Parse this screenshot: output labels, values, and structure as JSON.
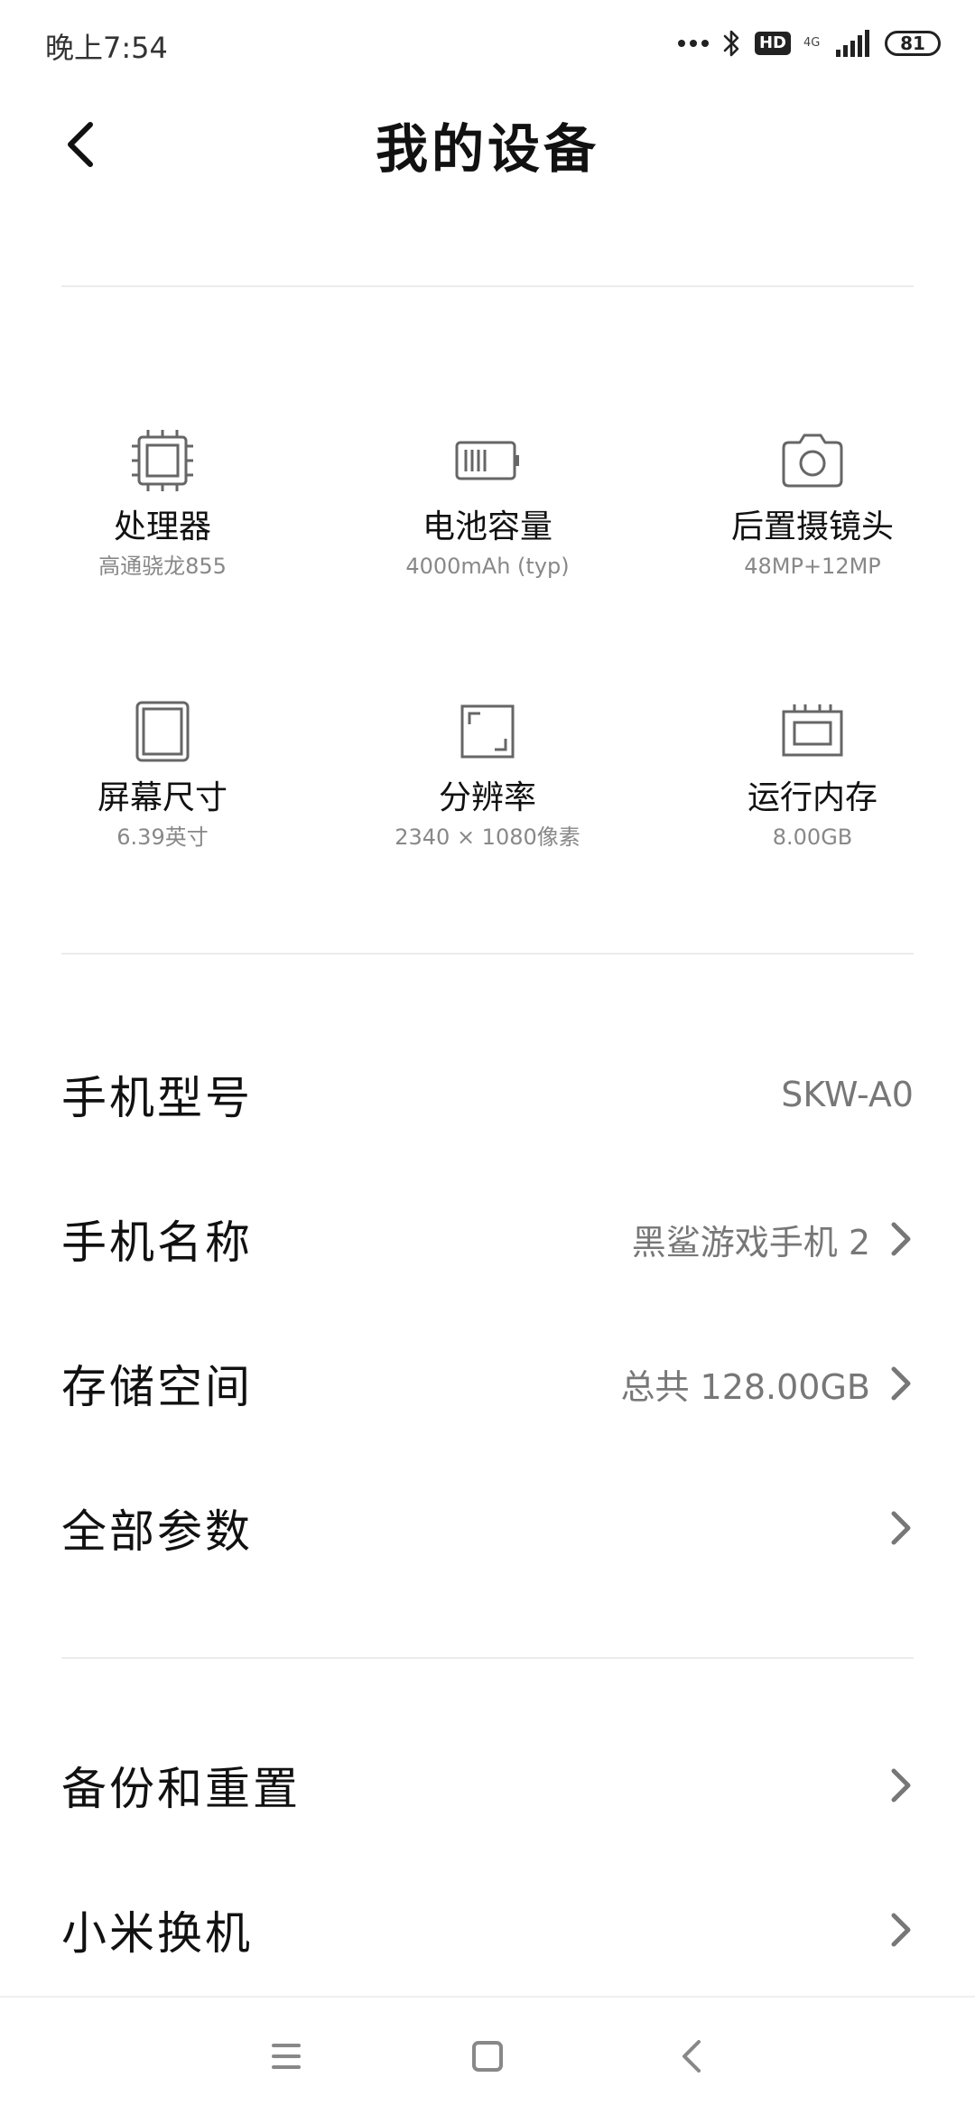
{
  "status_bar": {
    "time": "晚上7:54",
    "network": "4G",
    "hd": "HD",
    "battery": "81"
  },
  "header": {
    "title": "我的设备"
  },
  "specs": [
    {
      "label": "处理器",
      "value": "高通骁龙855",
      "icon": "processor-icon"
    },
    {
      "label": "电池容量",
      "value": "4000mAh (typ)",
      "icon": "battery-icon"
    },
    {
      "label": "后置摄镜头",
      "value": "48MP+12MP",
      "icon": "camera-icon"
    },
    {
      "label": "屏幕尺寸",
      "value": "6.39英寸",
      "icon": "screen-icon"
    },
    {
      "label": "分辨率",
      "value": "2340 × 1080像素",
      "icon": "resolution-icon"
    },
    {
      "label": "运行内存",
      "value": "8.00GB",
      "icon": "memory-icon"
    }
  ],
  "rows": [
    {
      "label": "手机型号",
      "value": "SKW-A0"
    },
    {
      "label": "手机名称",
      "value": "黑鲨游戏手机 2"
    },
    {
      "label": "存储空间",
      "value": "总共 128.00GB"
    },
    {
      "label": "全部参数",
      "value": ""
    },
    {
      "label": "备份和重置",
      "value": ""
    },
    {
      "label": "小米换机",
      "value": ""
    }
  ]
}
